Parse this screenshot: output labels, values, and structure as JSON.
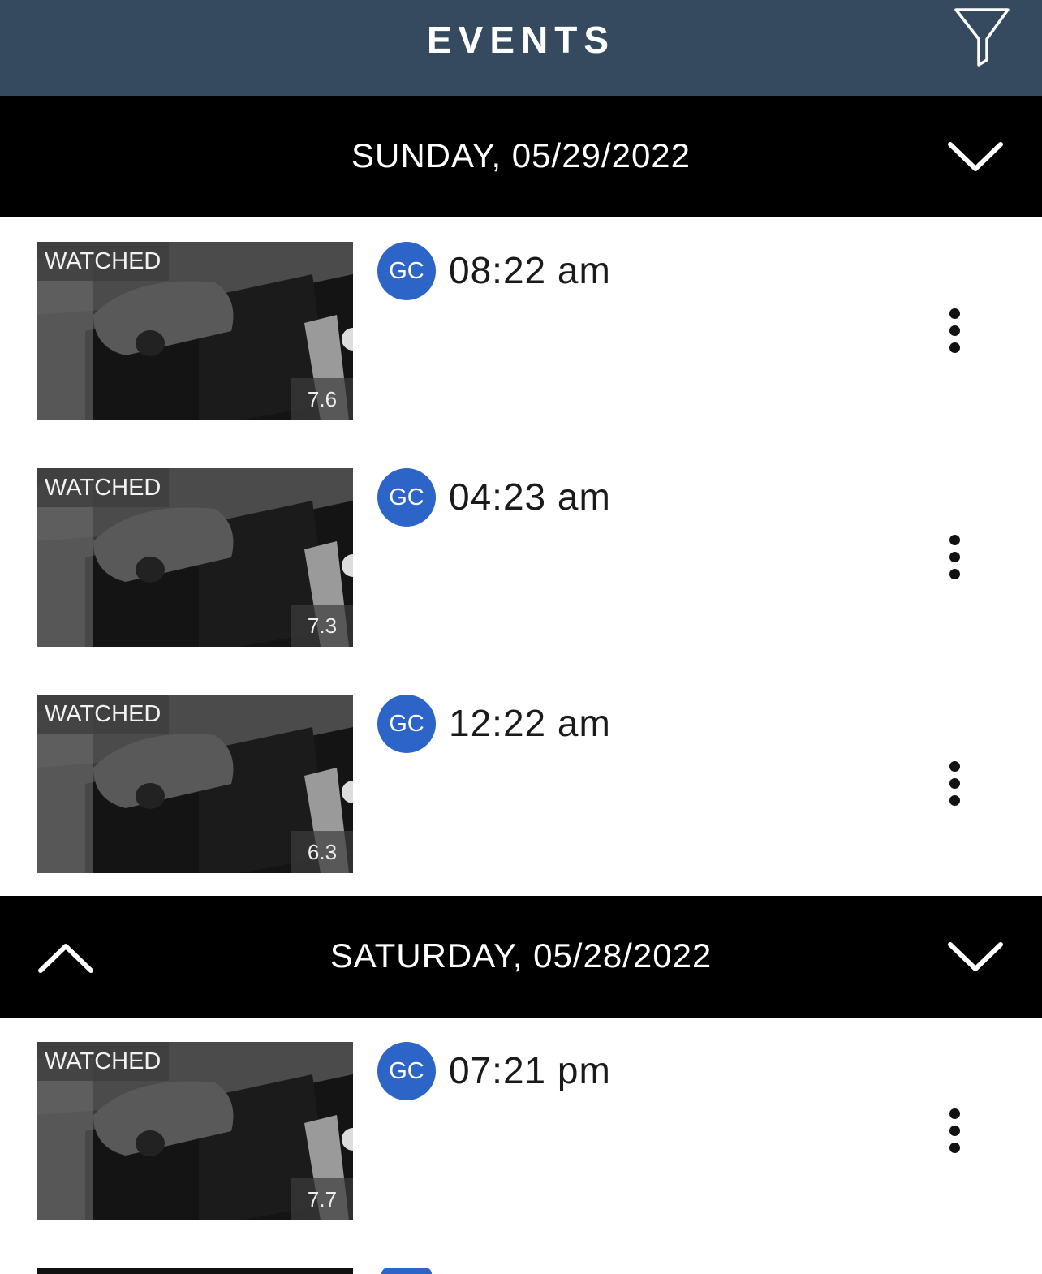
{
  "header": {
    "title": "EVENTS",
    "filter_icon": "filter-icon",
    "background": "#354a5f"
  },
  "days": [
    {
      "date": "SUNDAY, 05/29/2022",
      "expand_icon": "chevron-down-icon",
      "events": [
        {
          "status": "WATCHED",
          "duration": "7.6",
          "initials": "GC",
          "time": "08:22 am"
        },
        {
          "status": "WATCHED",
          "duration": "7.3",
          "initials": "GC",
          "time": "04:23 am"
        },
        {
          "status": "WATCHED",
          "duration": "6.3",
          "initials": "GC",
          "time": "12:22 am"
        }
      ]
    },
    {
      "date": "SATURDAY, 05/28/2022",
      "collapse_icon": "chevron-up-icon",
      "expand_icon": "chevron-down-icon",
      "events": [
        {
          "status": "WATCHED",
          "duration": "7.7",
          "initials": "GC",
          "time": "07:21 pm"
        }
      ]
    }
  ],
  "colors": {
    "avatar": "#2d64c8",
    "day_header": "#000000"
  }
}
